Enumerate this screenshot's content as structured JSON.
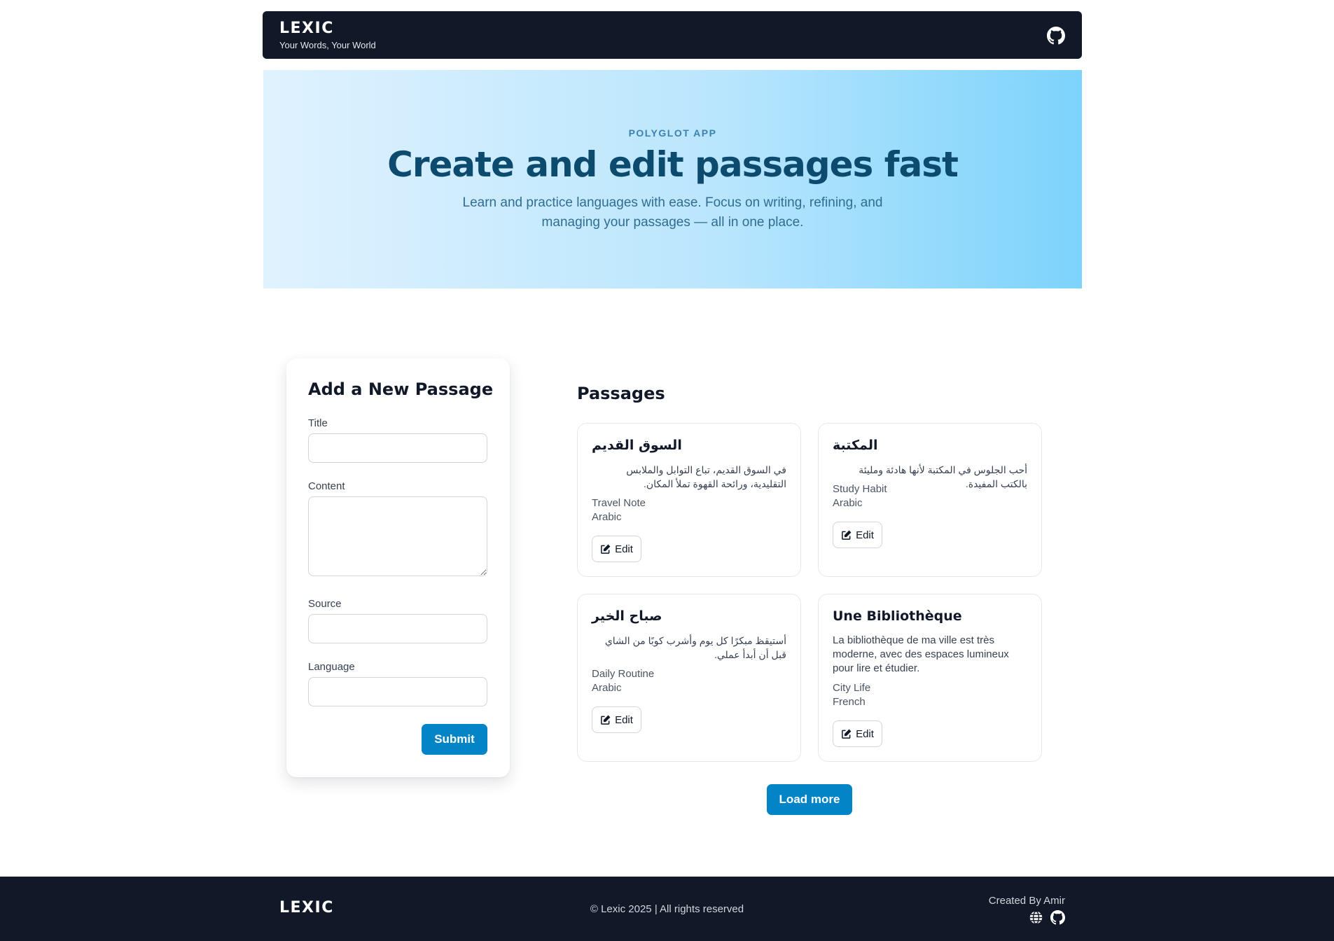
{
  "navbar": {
    "brand": "LEXIC",
    "tagline": "Your Words, Your World",
    "github_icon": "github-icon"
  },
  "hero": {
    "eyebrow": "POLYGLOT APP",
    "title": "Create and edit passages fast",
    "subtitle": "Learn and practice languages with ease. Focus on writing, refining, and managing your passages — all in one place."
  },
  "form": {
    "title": "Add a New Passage",
    "title_label": "Title",
    "title_value": "",
    "content_label": "Content",
    "content_value": "",
    "source_label": "Source",
    "source_value": "",
    "language_label": "Language",
    "language_value": "",
    "submit_label": "Submit"
  },
  "passages": {
    "heading": "Passages",
    "edit_label": "Edit",
    "items": [
      {
        "title": "السوق القديم",
        "content": "في السوق القديم، تباع التوابل والملابس التقليدية، ورائحة القهوة تملأ المكان.",
        "source": "Travel Note",
        "language": "Arabic"
      },
      {
        "title": "المكتبة",
        "content": "أحب الجلوس في المكتبة لأنها هادئة ومليئة بالكتب المفيدة.",
        "source": "Study Habit",
        "language": "Arabic"
      },
      {
        "title": "صباح الخير",
        "content": "أستيقظ مبكرًا كل يوم وأشرب كوبًا من الشاي قبل أن أبدأ عملي.",
        "source": "Daily Routine",
        "language": "Arabic"
      },
      {
        "title": "Une Bibliothèque",
        "content": "La bibliothèque de ma ville est très moderne, avec des espaces lumineux pour lire et étudier.",
        "source": "City Life",
        "language": "French"
      }
    ],
    "load_more_label": "Load more"
  },
  "footer": {
    "brand": "LEXIC",
    "copyright": "© Lexic 2025 | All rights reserved",
    "created_by": "Created By Amir",
    "icons": [
      "globe-icon",
      "github-icon"
    ]
  },
  "colors": {
    "navbar_bg": "#111827",
    "accent": "#0284c7",
    "hero_title": "#0c4a6e",
    "hero_gradient_start": "#e0f2fe",
    "hero_gradient_end": "#7dd3fc"
  }
}
